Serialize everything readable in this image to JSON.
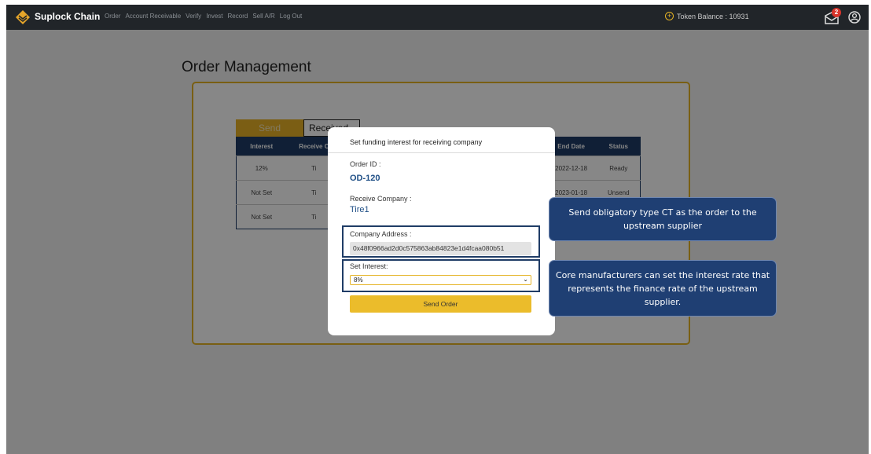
{
  "navbar": {
    "brand": "Suplock Chain",
    "menu": [
      "Order",
      "Account Receivable",
      "Verify",
      "Invest",
      "Record",
      "Sell A/R",
      "Log Out"
    ],
    "token_label": "Token Balance : 10931",
    "mail_badge": "2",
    "colors": {
      "background": "#212529",
      "accent": "#e5b325"
    }
  },
  "page": {
    "title": "Order Management",
    "tabs": {
      "send": "Send",
      "received": "Received"
    }
  },
  "table": {
    "headers": [
      "Interest",
      "Receive C",
      "",
      "End Date",
      "Status"
    ],
    "rows": [
      {
        "interest": "12%",
        "company": "Ti",
        "end_date": "2022-12-18",
        "status": "Ready"
      },
      {
        "interest": "Not Set",
        "company": "Ti",
        "end_date": "2023-01-18",
        "status": "Unsend"
      },
      {
        "interest": "Not Set",
        "company": "Ti",
        "end_date": "",
        "status": ""
      }
    ]
  },
  "modal": {
    "title": "Set funding interest for receiving company",
    "order_id_label": "Order ID :",
    "order_id": "OD-120",
    "receive_company_label": "Receive Company :",
    "receive_company": "Tire1",
    "company_address_label": "Company Address :",
    "company_address": "0x48f0966ad2d0c575863ab84823e1d4fcaa080b51",
    "set_interest_label": "Set Interest:",
    "interest_selected": "8%",
    "send_button": "Send Order"
  },
  "callouts": {
    "first": "Send obligatory type CT as the order to the upstream supplier",
    "second": "Core manufacturers can set the interest rate that represents the finance rate of the upstream supplier."
  }
}
